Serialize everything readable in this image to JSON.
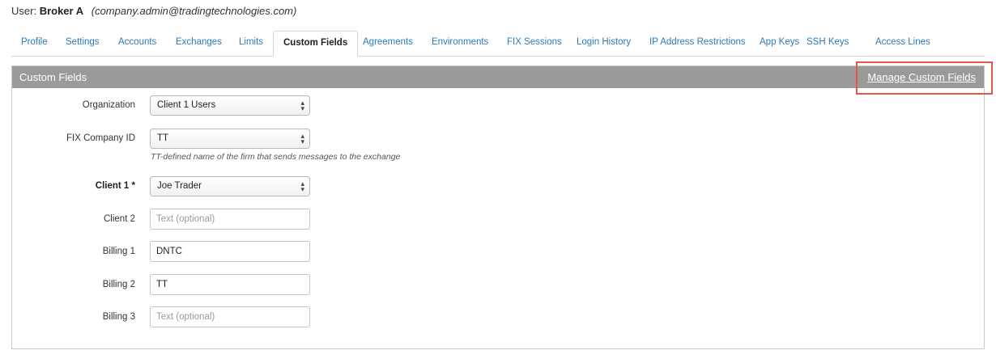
{
  "user": {
    "prefix": "User:",
    "name": "Broker A",
    "email": "(company.admin@tradingtechnologies.com)"
  },
  "tabs": [
    {
      "label": "Profile"
    },
    {
      "label": "Settings"
    },
    {
      "label": "Accounts"
    },
    {
      "label": "Exchanges"
    },
    {
      "label": "Limits"
    },
    {
      "label": "Custom Fields",
      "active": true
    },
    {
      "label": "Agreements"
    },
    {
      "label": "Environments"
    },
    {
      "label": "FIX Sessions"
    },
    {
      "label": "Login History"
    },
    {
      "label": "IP Address Restrictions"
    },
    {
      "label": "App Keys"
    },
    {
      "label": "SSH Keys"
    },
    {
      "label": "Access Lines"
    }
  ],
  "panel": {
    "title": "Custom Fields",
    "manage_link": "Manage Custom Fields"
  },
  "form": {
    "organization": {
      "label": "Organization",
      "value": "Client 1 Users"
    },
    "fix_company_id": {
      "label": "FIX Company ID",
      "value": "TT",
      "help": "TT-defined name of the firm that sends messages to the exchange"
    },
    "client1": {
      "label": "Client 1 *",
      "value": "Joe Trader"
    },
    "client2": {
      "label": "Client 2",
      "value": "",
      "placeholder": "Text (optional)"
    },
    "billing1": {
      "label": "Billing 1",
      "value": "DNTC"
    },
    "billing2": {
      "label": "Billing 2",
      "value": "TT"
    },
    "billing3": {
      "label": "Billing 3",
      "value": "",
      "placeholder": "Text (optional)"
    }
  },
  "colors": {
    "link": "#2a7ab9",
    "header_bg": "#9a9a9a",
    "highlight": "#e5574a"
  }
}
